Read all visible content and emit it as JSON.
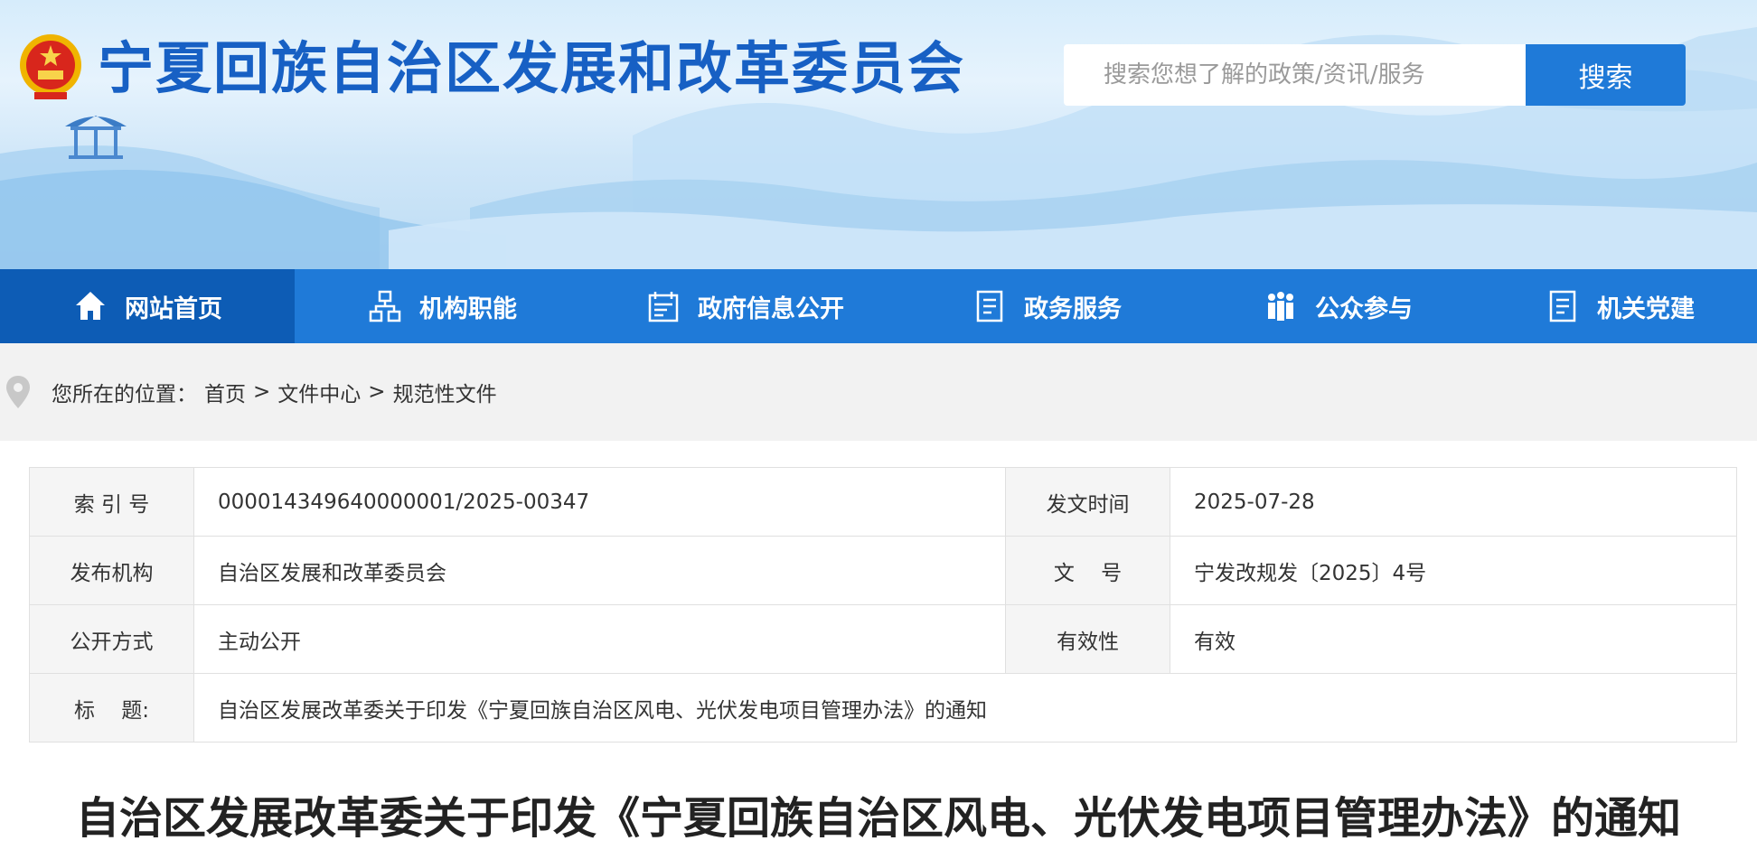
{
  "header": {
    "site_title": "宁夏回族自治区发展和改革委员会",
    "search_placeholder": "搜索您想了解的政策/资讯/服务",
    "search_button": "搜索"
  },
  "nav": {
    "items": [
      {
        "label": "网站首页",
        "icon": "home-icon",
        "active": true
      },
      {
        "label": "机构职能",
        "icon": "org-chart-icon"
      },
      {
        "label": "政府信息公开",
        "icon": "calendar-list-icon"
      },
      {
        "label": "政务服务",
        "icon": "document-list-icon"
      },
      {
        "label": "公众参与",
        "icon": "people-icon"
      },
      {
        "label": "机关党建",
        "icon": "document-list-icon"
      }
    ]
  },
  "breadcrumb": {
    "prefix": "您所在的位置：",
    "items": [
      "首页",
      "文件中心",
      "规范性文件"
    ],
    "separator": ">"
  },
  "info": {
    "index_no_label": "索 引 号",
    "index_no": "000014349640000001/2025-00347",
    "date_label": "发文时间",
    "date": "2025-07-28",
    "issuer_label": "发布机构",
    "issuer": "自治区发展和改革委员会",
    "doc_no_label": "文    号",
    "doc_no": "宁发改规发〔2025〕4号",
    "disclosure_label": "公开方式",
    "disclosure": "主动公开",
    "validity_label": "有效性",
    "validity": "有效",
    "title_label": "标    题:",
    "title": "自治区发展改革委关于印发《宁夏回族自治区风电、光伏发电项目管理办法》的通知"
  },
  "document": {
    "title": "自治区发展改革委关于印发《宁夏回族自治区风电、光伏发电项目管理办法》的通知"
  },
  "colors": {
    "nav_blue": "#1f7ad8",
    "nav_active": "#0d5cb5",
    "title_blue": "#1760c4"
  }
}
